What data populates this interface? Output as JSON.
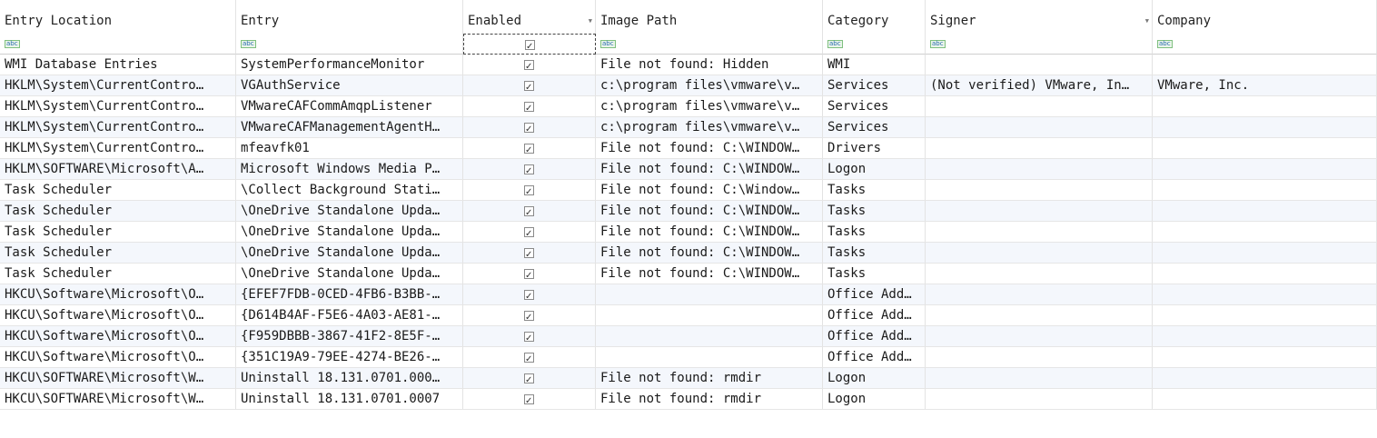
{
  "columns": [
    "Entry Location",
    "Entry",
    "Enabled",
    "Image Path",
    "Category",
    "Signer",
    "Company"
  ],
  "rows": [
    {
      "location": "WMI Database Entries",
      "entry": "SystemPerformanceMonitor",
      "image_path": "File not found: Hidden",
      "category": "WMI",
      "signer": "",
      "company": ""
    },
    {
      "location": "HKLM\\System\\CurrentContro…",
      "entry": "VGAuthService",
      "image_path": "c:\\program files\\vmware\\v…",
      "category": "Services",
      "signer": "(Not verified) VMware, In…",
      "company": "VMware, Inc."
    },
    {
      "location": "HKLM\\System\\CurrentContro…",
      "entry": "VMwareCAFCommAmqpListener",
      "image_path": "c:\\program files\\vmware\\v…",
      "category": "Services",
      "signer": "",
      "company": ""
    },
    {
      "location": "HKLM\\System\\CurrentContro…",
      "entry": "VMwareCAFManagementAgentH…",
      "image_path": "c:\\program files\\vmware\\v…",
      "category": "Services",
      "signer": "",
      "company": ""
    },
    {
      "location": "HKLM\\System\\CurrentContro…",
      "entry": "mfeavfk01",
      "image_path": "File not found: C:\\WINDOW…",
      "category": "Drivers",
      "signer": "",
      "company": ""
    },
    {
      "location": "HKLM\\SOFTWARE\\Microsoft\\A…",
      "entry": "Microsoft Windows Media P…",
      "image_path": "File not found: C:\\WINDOW…",
      "category": "Logon",
      "signer": "",
      "company": ""
    },
    {
      "location": "Task Scheduler",
      "entry": "\\Collect Background Stati…",
      "image_path": "File not found: C:\\Window…",
      "category": "Tasks",
      "signer": "",
      "company": ""
    },
    {
      "location": "Task Scheduler",
      "entry": "\\OneDrive Standalone Upda…",
      "image_path": "File not found: C:\\WINDOW…",
      "category": "Tasks",
      "signer": "",
      "company": ""
    },
    {
      "location": "Task Scheduler",
      "entry": "\\OneDrive Standalone Upda…",
      "image_path": "File not found: C:\\WINDOW…",
      "category": "Tasks",
      "signer": "",
      "company": ""
    },
    {
      "location": "Task Scheduler",
      "entry": "\\OneDrive Standalone Upda…",
      "image_path": "File not found: C:\\WINDOW…",
      "category": "Tasks",
      "signer": "",
      "company": ""
    },
    {
      "location": "Task Scheduler",
      "entry": "\\OneDrive Standalone Upda…",
      "image_path": "File not found: C:\\WINDOW…",
      "category": "Tasks",
      "signer": "",
      "company": ""
    },
    {
      "location": "HKCU\\Software\\Microsoft\\O…",
      "entry": "{EFEF7FDB-0CED-4FB6-B3BB-…",
      "image_path": "",
      "category": "Office Add…",
      "signer": "",
      "company": ""
    },
    {
      "location": "HKCU\\Software\\Microsoft\\O…",
      "entry": "{D614B4AF-F5E6-4A03-AE81-…",
      "image_path": "",
      "category": "Office Add…",
      "signer": "",
      "company": ""
    },
    {
      "location": "HKCU\\Software\\Microsoft\\O…",
      "entry": "{F959DBBB-3867-41F2-8E5F-…",
      "image_path": "",
      "category": "Office Add…",
      "signer": "",
      "company": ""
    },
    {
      "location": "HKCU\\Software\\Microsoft\\O…",
      "entry": "{351C19A9-79EE-4274-BE26-…",
      "image_path": "",
      "category": "Office Add…",
      "signer": "",
      "company": ""
    },
    {
      "location": "HKCU\\SOFTWARE\\Microsoft\\W…",
      "entry": "Uninstall 18.131.0701.000…",
      "image_path": "File not found: rmdir",
      "category": "Logon",
      "signer": "",
      "company": ""
    },
    {
      "location": "HKCU\\SOFTWARE\\Microsoft\\W…",
      "entry": "Uninstall 18.131.0701.0007",
      "image_path": "File not found: rmdir",
      "category": "Logon",
      "signer": "",
      "company": ""
    }
  ],
  "filter_icon": "abc-text-filter-icon",
  "accent_colors": {
    "filter_green": "#7fbf7f",
    "filter_blue": "#2b6bb0",
    "row_alt": "#f4f7fc"
  }
}
